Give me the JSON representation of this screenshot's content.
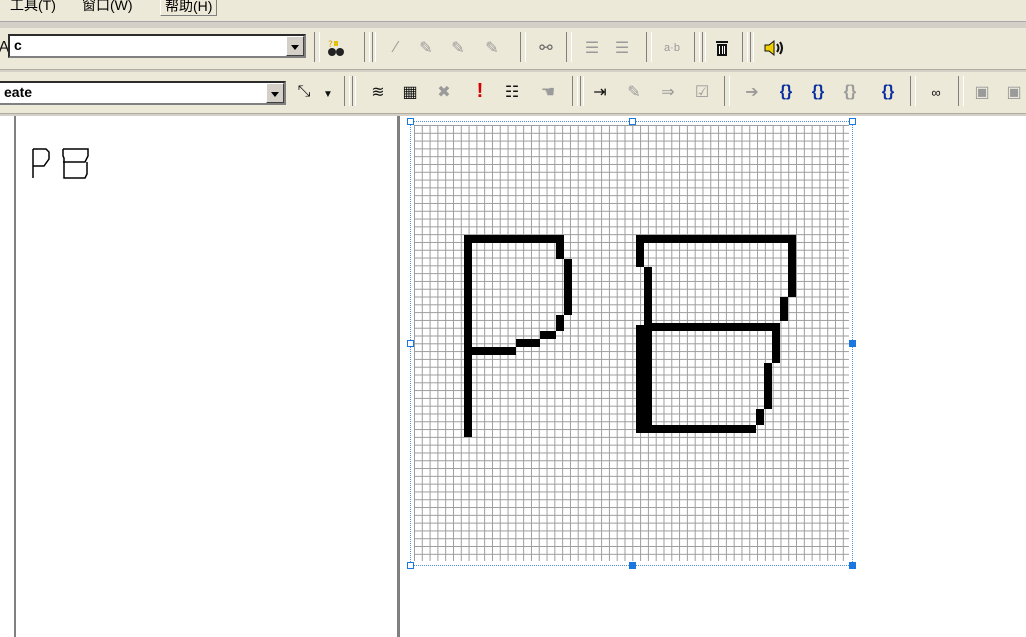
{
  "menubar": {
    "tools": "工具(T)",
    "window": "窗口(W)",
    "help": "帮助(H)"
  },
  "toolbar1": {
    "combo_value": "c",
    "icons": [
      "binoculars-help-icon",
      "glyph-arrow-icon",
      "glyph-add-icon",
      "glyph-remove-icon",
      "glyph-edit-icon",
      "find-icon",
      "indent-icon",
      "outdent-icon",
      "ab-icon",
      "trash-icon",
      "speaker-icon"
    ]
  },
  "toolbar2": {
    "combo_value": "eate",
    "icons": [
      "magic-wand-icon",
      "stack-icon",
      "grid-icon",
      "delete-icon",
      "exclamation-icon",
      "list-icon",
      "hand-icon",
      "export-icon",
      "edit-icon",
      "send-icon",
      "check-icon",
      "arrow-right-icon",
      "step-icon",
      "step-over-icon",
      "step-gray-icon",
      "step-in-icon",
      "glasses-icon",
      "window-icon",
      "window-icon-2"
    ]
  },
  "preview": {
    "text": "PB"
  },
  "colors": {
    "chrome": "#ece9d8",
    "selection": "#1b77e0",
    "glyph": "#000000"
  }
}
